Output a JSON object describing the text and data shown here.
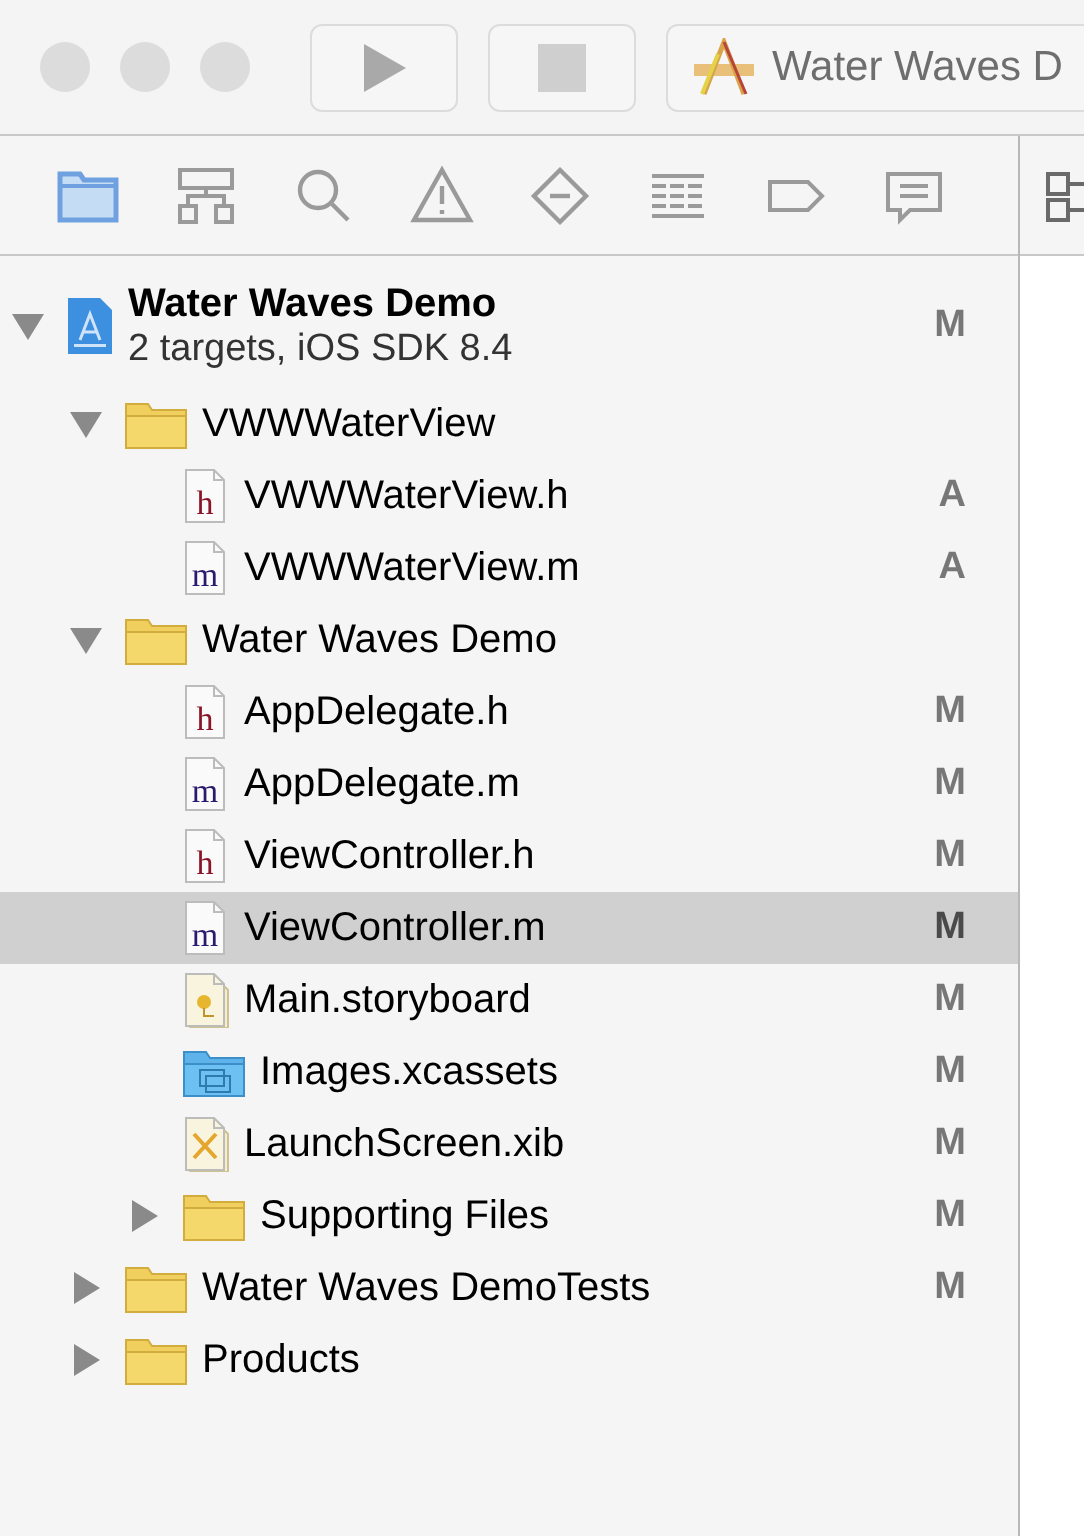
{
  "toolbar": {
    "scheme": "Water Waves D"
  },
  "navigator_tabs": [
    {
      "kind": "folder",
      "selected": true
    },
    {
      "kind": "hierarchy",
      "selected": false
    },
    {
      "kind": "search",
      "selected": false
    },
    {
      "kind": "warning",
      "selected": false
    },
    {
      "kind": "test",
      "selected": false
    },
    {
      "kind": "debug",
      "selected": false
    },
    {
      "kind": "breakpoint",
      "selected": false
    },
    {
      "kind": "report",
      "selected": false
    }
  ],
  "tree": [
    {
      "kind": "project",
      "name": "Water Waves Demo",
      "subtitle": "2 targets, iOS SDK 8.4",
      "status": "M",
      "expanded": true,
      "selected": false,
      "children": [
        {
          "kind": "folder",
          "name": "VWWWaterView",
          "expanded": true,
          "selected": false,
          "children": [
            {
              "kind": "header",
              "icon_letter": "h",
              "name": "VWWWaterView.h",
              "status": "A",
              "selected": false
            },
            {
              "kind": "source",
              "icon_letter": "m",
              "name": "VWWWaterView.m",
              "status": "A",
              "selected": false
            }
          ]
        },
        {
          "kind": "folder",
          "name": "Water Waves Demo",
          "expanded": true,
          "selected": false,
          "children": [
            {
              "kind": "header",
              "icon_letter": "h",
              "name": "AppDelegate.h",
              "status": "M",
              "selected": false
            },
            {
              "kind": "source",
              "icon_letter": "m",
              "name": "AppDelegate.m",
              "status": "M",
              "selected": false
            },
            {
              "kind": "header",
              "icon_letter": "h",
              "name": "ViewController.h",
              "status": "M",
              "selected": false
            },
            {
              "kind": "source",
              "icon_letter": "m",
              "name": "ViewController.m",
              "status": "M",
              "selected": true
            },
            {
              "kind": "storyboard",
              "name": "Main.storyboard",
              "status": "M",
              "selected": false
            },
            {
              "kind": "assets",
              "name": "Images.xcassets",
              "status": "M",
              "selected": false
            },
            {
              "kind": "xib",
              "name": "LaunchScreen.xib",
              "status": "M",
              "selected": false
            },
            {
              "kind": "folder",
              "name": "Supporting Files",
              "status": "M",
              "expanded": false,
              "selected": false
            }
          ]
        },
        {
          "kind": "folder",
          "name": "Water Waves DemoTests",
          "status": "M",
          "expanded": false,
          "selected": false
        },
        {
          "kind": "folder",
          "name": "Products",
          "expanded": false,
          "selected": false
        }
      ]
    }
  ]
}
